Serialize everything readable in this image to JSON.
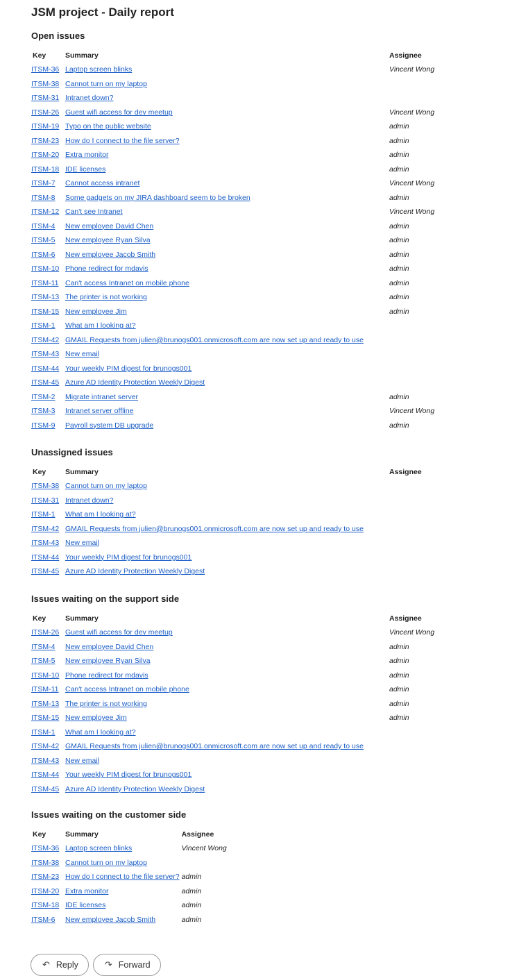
{
  "title": "JSM project - Daily report",
  "columns": {
    "key": "Key",
    "summary": "Summary",
    "assignee": "Assignee"
  },
  "sections": [
    {
      "heading": "Open issues",
      "rows": [
        {
          "key": "ITSM-36",
          "summary": "Laptop screen blinks",
          "assignee": "Vincent Wong"
        },
        {
          "key": "ITSM-38",
          "summary": "Cannot turn on my laptop",
          "assignee": ""
        },
        {
          "key": "ITSM-31",
          "summary": "Intranet down?",
          "assignee": ""
        },
        {
          "key": "ITSM-26",
          "summary": "Guest wifi access for dev meetup",
          "assignee": "Vincent Wong"
        },
        {
          "key": "ITSM-19",
          "summary": "Typo on the public website",
          "assignee": "admin"
        },
        {
          "key": "ITSM-23",
          "summary": "How do I connect to the file server?",
          "assignee": "admin"
        },
        {
          "key": "ITSM-20",
          "summary": "Extra monitor",
          "assignee": "admin"
        },
        {
          "key": "ITSM-18",
          "summary": "IDE licenses",
          "assignee": "admin"
        },
        {
          "key": "ITSM-7",
          "summary": "Cannot access intranet",
          "assignee": "Vincent Wong"
        },
        {
          "key": "ITSM-8",
          "summary": "Some gadgets on my JIRA dashboard seem to be broken",
          "assignee": "admin"
        },
        {
          "key": "ITSM-12",
          "summary": "Can't see Intranet",
          "assignee": "Vincent Wong"
        },
        {
          "key": "ITSM-4",
          "summary": "New employee David Chen",
          "assignee": "admin"
        },
        {
          "key": "ITSM-5",
          "summary": "New employee Ryan Silva",
          "assignee": "admin"
        },
        {
          "key": "ITSM-6",
          "summary": "New employee Jacob Smith",
          "assignee": "admin"
        },
        {
          "key": "ITSM-10",
          "summary": "Phone redirect for mdavis",
          "assignee": "admin"
        },
        {
          "key": "ITSM-11",
          "summary": "Can't access Intranet on mobile phone",
          "assignee": "admin"
        },
        {
          "key": "ITSM-13",
          "summary": "The printer is not working",
          "assignee": "admin"
        },
        {
          "key": "ITSM-15",
          "summary": "New employee Jim",
          "assignee": "admin"
        },
        {
          "key": "ITSM-1",
          "summary": "What am I looking at?",
          "assignee": ""
        },
        {
          "key": "ITSM-42",
          "summary": "GMAIL Requests from julien@brunogs001.onmicrosoft.com are now set up and ready to use",
          "assignee": ""
        },
        {
          "key": "ITSM-43",
          "summary": "New email",
          "assignee": ""
        },
        {
          "key": "ITSM-44",
          "summary": "Your weekly PIM digest for brunogs001",
          "assignee": ""
        },
        {
          "key": "ITSM-45",
          "summary": "Azure AD Identity Protection Weekly Digest",
          "assignee": ""
        },
        {
          "key": "ITSM-2",
          "summary": "Migrate intranet server",
          "assignee": "admin"
        },
        {
          "key": "ITSM-3",
          "summary": "Intranet server offline",
          "assignee": "Vincent Wong"
        },
        {
          "key": "ITSM-9",
          "summary": "Payroll system DB upgrade",
          "assignee": "admin"
        }
      ]
    },
    {
      "heading": "Unassigned issues",
      "rows": [
        {
          "key": "ITSM-38",
          "summary": "Cannot turn on my laptop",
          "assignee": ""
        },
        {
          "key": "ITSM-31",
          "summary": "Intranet down?",
          "assignee": ""
        },
        {
          "key": "ITSM-1",
          "summary": "What am I looking at?",
          "assignee": ""
        },
        {
          "key": "ITSM-42",
          "summary": "GMAIL Requests from julien@brunogs001.onmicrosoft.com are now set up and ready to use",
          "assignee": ""
        },
        {
          "key": "ITSM-43",
          "summary": "New email",
          "assignee": ""
        },
        {
          "key": "ITSM-44",
          "summary": "Your weekly PIM digest for brunogs001",
          "assignee": ""
        },
        {
          "key": "ITSM-45",
          "summary": "Azure AD Identity Protection Weekly Digest",
          "assignee": ""
        }
      ]
    },
    {
      "heading": "Issues waiting on the support side",
      "rows": [
        {
          "key": "ITSM-26",
          "summary": "Guest wifi access for dev meetup",
          "assignee": "Vincent Wong"
        },
        {
          "key": "ITSM-4",
          "summary": "New employee David Chen",
          "assignee": "admin"
        },
        {
          "key": "ITSM-5",
          "summary": "New employee Ryan Silva",
          "assignee": "admin"
        },
        {
          "key": "ITSM-10",
          "summary": "Phone redirect for mdavis",
          "assignee": "admin"
        },
        {
          "key": "ITSM-11",
          "summary": "Can't access Intranet on mobile phone",
          "assignee": "admin"
        },
        {
          "key": "ITSM-13",
          "summary": "The printer is not working",
          "assignee": "admin"
        },
        {
          "key": "ITSM-15",
          "summary": "New employee Jim",
          "assignee": "admin"
        },
        {
          "key": "ITSM-1",
          "summary": "What am I looking at?",
          "assignee": ""
        },
        {
          "key": "ITSM-42",
          "summary": "GMAIL Requests from julien@brunogs001.onmicrosoft.com are now set up and ready to use",
          "assignee": ""
        },
        {
          "key": "ITSM-43",
          "summary": "New email",
          "assignee": ""
        },
        {
          "key": "ITSM-44",
          "summary": "Your weekly PIM digest for brunogs001",
          "assignee": ""
        },
        {
          "key": "ITSM-45",
          "summary": "Azure AD Identity Protection Weekly Digest",
          "assignee": ""
        }
      ]
    },
    {
      "heading": "Issues waiting on the customer side",
      "rows": [
        {
          "key": "ITSM-36",
          "summary": "Laptop screen blinks",
          "assignee": "Vincent Wong"
        },
        {
          "key": "ITSM-38",
          "summary": "Cannot turn on my laptop",
          "assignee": ""
        },
        {
          "key": "ITSM-23",
          "summary": "How do I connect to the file server?",
          "assignee": "admin"
        },
        {
          "key": "ITSM-20",
          "summary": "Extra monitor",
          "assignee": "admin"
        },
        {
          "key": "ITSM-18",
          "summary": "IDE licenses",
          "assignee": "admin"
        },
        {
          "key": "ITSM-6",
          "summary": "New employee Jacob Smith",
          "assignee": "admin"
        }
      ]
    }
  ],
  "actions": {
    "reply": {
      "label": "Reply",
      "icon": "reply-arrow-icon"
    },
    "forward": {
      "label": "Forward",
      "icon": "forward-arrow-icon"
    }
  },
  "colors": {
    "link": "#1a5dc7",
    "text": "#222222"
  }
}
